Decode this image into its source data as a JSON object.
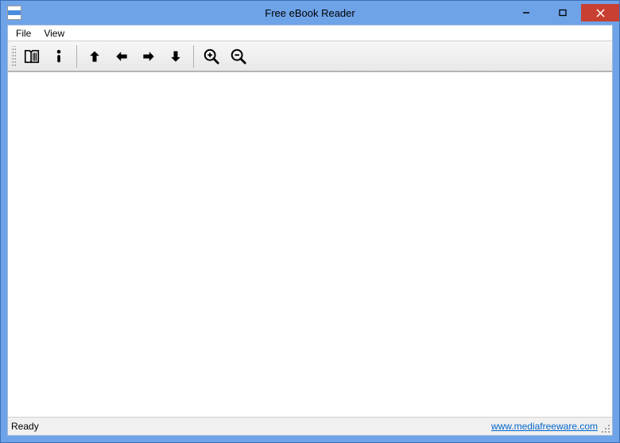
{
  "window": {
    "title": "Free eBook Reader"
  },
  "menubar": {
    "items": [
      "File",
      "View"
    ]
  },
  "toolbar": {
    "buttons": {
      "library": "library",
      "info": "info",
      "up": "up",
      "left": "left",
      "right": "right",
      "down": "down",
      "zoom_in": "zoom-in",
      "zoom_out": "zoom-out"
    }
  },
  "statusbar": {
    "status": "Ready",
    "link": "www.mediafreeware.com"
  }
}
